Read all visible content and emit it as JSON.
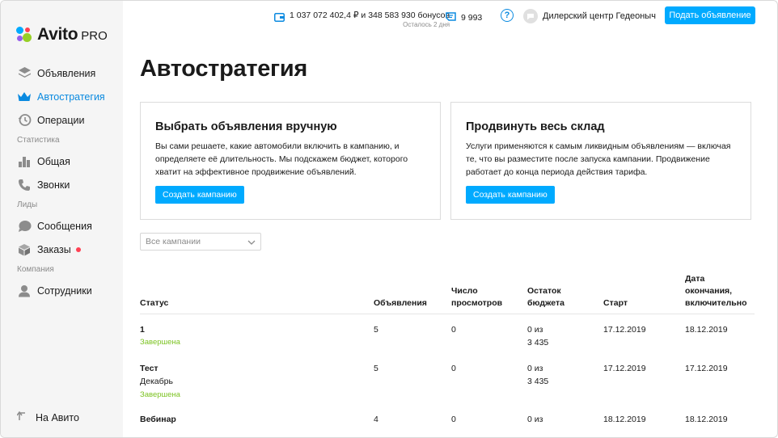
{
  "brand": {
    "name": "Avito",
    "suffix": "PRO",
    "dot_colors": [
      "#00aaff",
      "#ff4053",
      "#97cf26",
      "#965eeb"
    ]
  },
  "sidebar": {
    "items": [
      {
        "label": "Объявления",
        "icon": "layers-icon"
      },
      {
        "label": "Автостратегия",
        "icon": "crown-icon",
        "active": true
      },
      {
        "label": "Операции",
        "icon": "history-icon"
      }
    ],
    "sections": [
      {
        "title": "Статистика",
        "items": [
          {
            "label": "Общая",
            "icon": "bar-chart-icon"
          },
          {
            "label": "Звонки",
            "icon": "phone-icon"
          }
        ]
      },
      {
        "title": "Лиды",
        "items": [
          {
            "label": "Сообщения",
            "icon": "message-icon"
          },
          {
            "label": "Заказы",
            "icon": "box-icon",
            "badge": true
          }
        ]
      },
      {
        "title": "Компания",
        "items": [
          {
            "label": "Сотрудники",
            "icon": "user-icon"
          }
        ]
      }
    ],
    "back_label": "На Авито"
  },
  "header": {
    "wallet_amount": "1 037 072 402,4 ₽ и 348 583 930 бонусов",
    "wallet_sub": "Осталось 2 дня",
    "points": "9 993",
    "help": "?",
    "account_name": "Дилерский центр Гедеоныч",
    "post_button": "Подать объявление"
  },
  "page": {
    "title": "Автостратегия"
  },
  "cards": [
    {
      "title": "Выбрать объявления вручную",
      "text": "Вы сами решаете, какие автомобили включить в кампанию, и определяете её длительность. Мы подскажем бюджет, которого хватит на эффективное продвижение объявлений.",
      "button": "Создать кампанию"
    },
    {
      "title": "Продвинуть весь склад",
      "text": "Услуги применяются к самым ликвидным объявлениям — включая те, что вы разместите после запуска кампании. Продвижение работает до конца периода действия тарифа.",
      "button": "Создать кампанию"
    }
  ],
  "filter": {
    "selected": "Все кампании"
  },
  "table": {
    "headers": {
      "status": "Статус",
      "ads": "Объявления",
      "views_1": "Число",
      "views_2": "просмотров",
      "budget_1": "Остаток",
      "budget_2": "бюджета",
      "start": "Старт",
      "end_1": "Дата",
      "end_2": "окончания,",
      "end_3": "включительно"
    },
    "rows": [
      {
        "name": "1",
        "name2": "",
        "status": "Завершена",
        "ads": "5",
        "views": "0",
        "budget_1": "0 из",
        "budget_2": "3 435",
        "start": "17.12.2019",
        "end": "18.12.2019"
      },
      {
        "name": "Тест",
        "name2": "Декабрь",
        "status": "Завершена",
        "ads": "5",
        "views": "0",
        "budget_1": "0 из",
        "budget_2": "3 435",
        "start": "17.12.2019",
        "end": "17.12.2019"
      },
      {
        "name": "Вебинар",
        "name2": "",
        "status": "",
        "ads": "4",
        "views": "0",
        "budget_1": "0 из",
        "budget_2": "",
        "start": "18.12.2019",
        "end": "18.12.2019"
      }
    ]
  }
}
